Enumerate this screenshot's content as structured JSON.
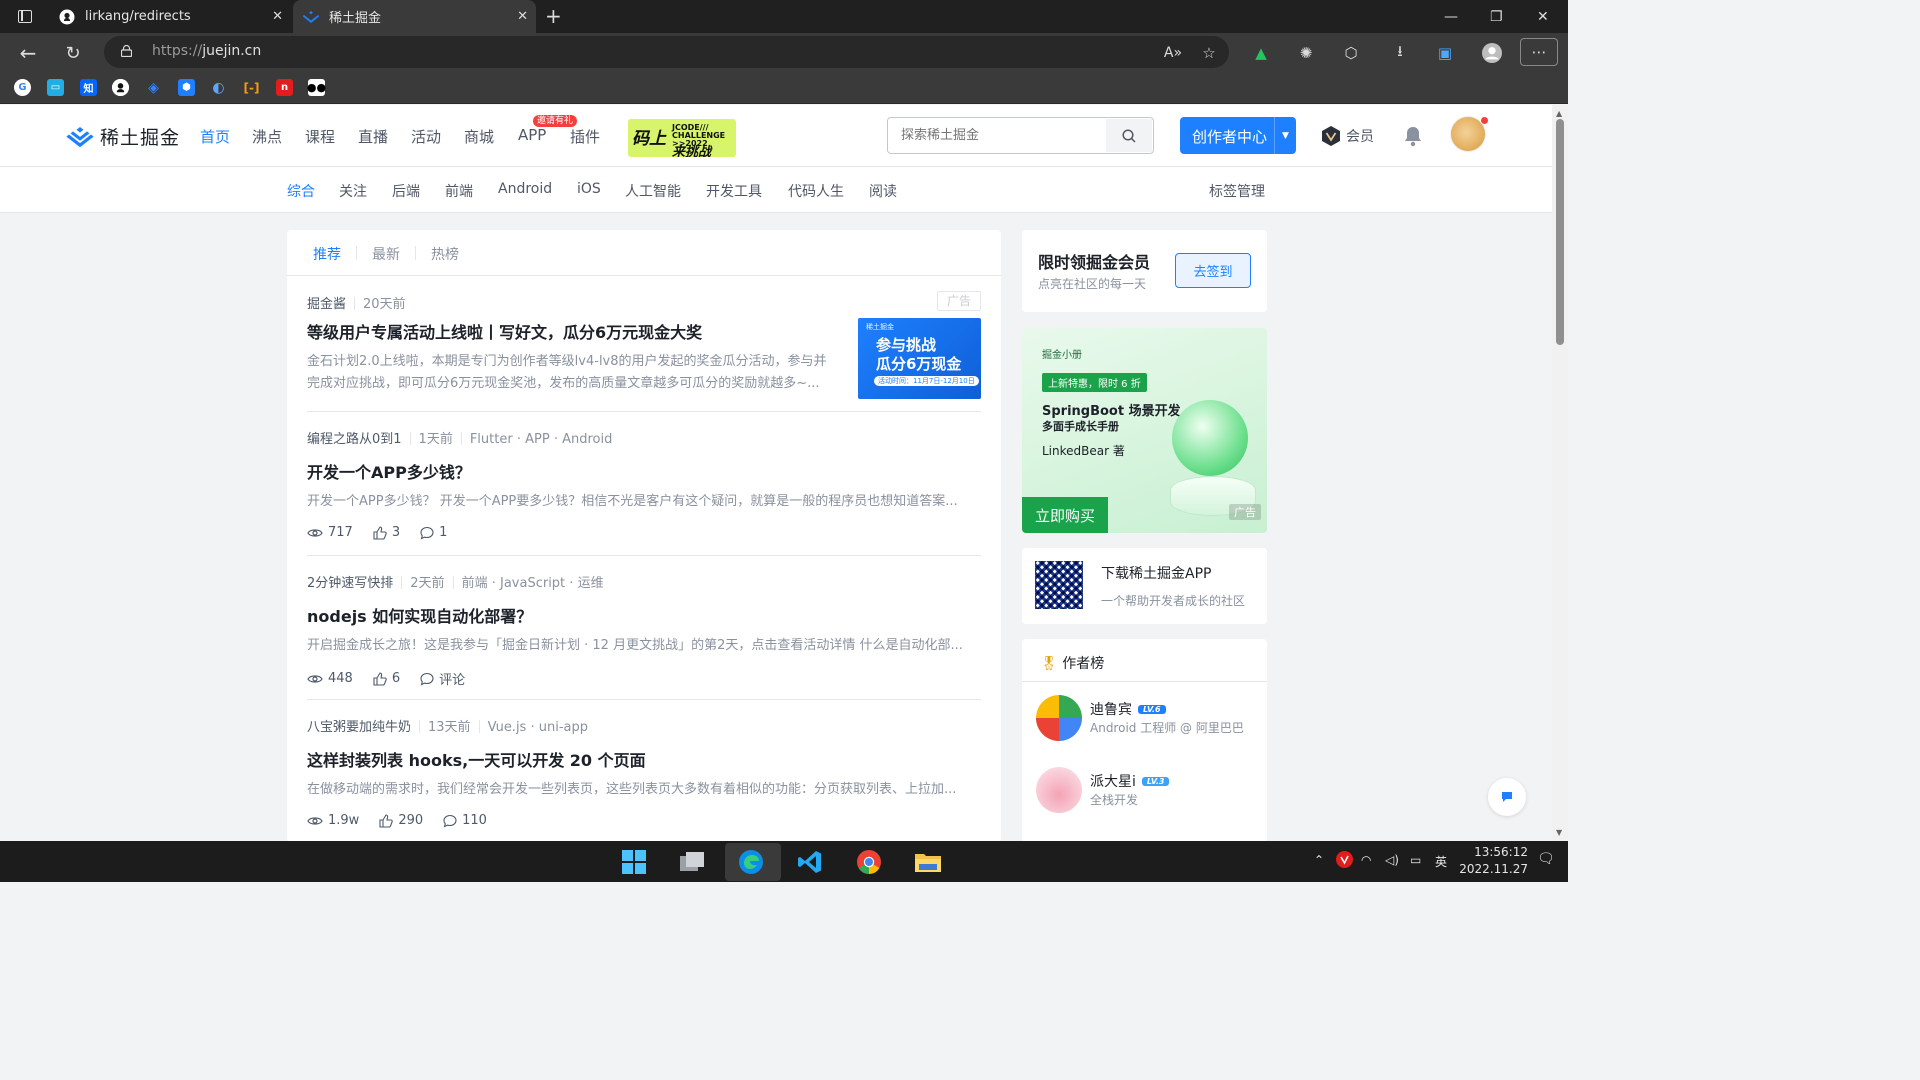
{
  "browser": {
    "tabs": [
      {
        "title": "lirkang/redirects",
        "icon": "github-icon"
      },
      {
        "title": "稀土掘金",
        "icon": "juejin-icon"
      }
    ],
    "url_scheme": "https://",
    "url_host": "juejin.cn",
    "bookmarks": [
      "google-icon",
      "bilibili-icon",
      "zhihu-icon",
      "github-icon",
      "diamond-icon",
      "hex-icon",
      "shield-icon",
      "bracket-icon",
      "n-icon",
      "medium-icon"
    ],
    "bookmark_zhi": "知"
  },
  "site": {
    "logo": "稀土掘金",
    "nav": [
      "首页",
      "沸点",
      "课程",
      "直播",
      "活动",
      "商城",
      "APP",
      "插件"
    ],
    "app_badge": "邀请有礼",
    "promo": {
      "big": "码上",
      "small": "JCODE/// CHALLENGE >>2022",
      "tag": "来挑战"
    },
    "search_placeholder": "探索稀土掘金",
    "creator": "创作者中心",
    "vip": "会员",
    "subnav": [
      "综合",
      "关注",
      "后端",
      "前端",
      "Android",
      "iOS",
      "人工智能",
      "开发工具",
      "代码人生",
      "阅读"
    ],
    "tag_manage": "标签管理"
  },
  "feed": {
    "tabs": [
      "推荐",
      "最新",
      "热榜"
    ],
    "ad": {
      "author": "掘金酱",
      "time": "20天前",
      "label": "广告",
      "title": "等级用户专属活动上线啦丨写好文，瓜分6万元现金大奖",
      "desc": "金石计划2.0上线啦，本期是专门为创作者等级lv4-lv8的用户发起的奖金瓜分活动，参与并完成对应挑战，即可瓜分6万元现金奖池，发布的高质量文章越多可瓜分的奖励就越多~...",
      "thumb": {
        "brand": "稀土掘金",
        "line1": "参与挑战",
        "line2": "瓜分6万现金",
        "date": "活动时间：11月7日-12月10日"
      }
    },
    "articles": [
      {
        "author": "编程之路从0到1",
        "time": "1天前",
        "tags": [
          "Flutter",
          "APP",
          "Android"
        ],
        "title": "开发一个APP多少钱？",
        "desc": "开发一个APP多少钱？ 开发一个APP要多少钱？相信不光是客户有这个疑问，就算是一般的程序员也想知道答案...",
        "views": "717",
        "likes": "3",
        "comments": "1"
      },
      {
        "author": "2分钟速写快排",
        "time": "2天前",
        "tags": [
          "前端",
          "JavaScript",
          "运维"
        ],
        "title": "nodejs 如何实现自动化部署？",
        "desc": "开启掘金成长之旅！这是我参与「掘金日新计划 · 12 月更文挑战」的第2天，点击查看活动详情 什么是自动化部...",
        "views": "448",
        "likes": "6",
        "comments": "评论"
      },
      {
        "author": "八宝粥要加纯牛奶",
        "time": "13天前",
        "tags": [
          "Vue.js",
          "uni-app"
        ],
        "title": "这样封装列表 hooks,一天可以开发 20 个页面",
        "desc": "在做移动端的需求时，我们经常会开发一些列表页，这些列表页大多数有着相似的功能：分页获取列表、上拉加...",
        "views": "1.9w",
        "likes": "290",
        "comments": "110"
      }
    ]
  },
  "sidebar": {
    "signin": {
      "title": "限时领掘金会员",
      "subtitle": "点亮在社区的每一天",
      "button": "去签到"
    },
    "bookad": {
      "brand": "掘金小册",
      "tag": "上新特惠，限时 6 折",
      "title": "SpringBoot 场景开发",
      "subtitle": "多面手成长手册",
      "author": "LinkedBear 著",
      "button": "立即购买",
      "ad": "广告"
    },
    "appdl": {
      "title": "下载稀土掘金APP",
      "subtitle": "一个帮助开发者成长的社区"
    },
    "authors": {
      "header": "作者榜",
      "list": [
        {
          "name": "迪鲁宾",
          "level": "LV.6",
          "desc": "Android 工程师 @ 阿里巴巴"
        },
        {
          "name": "派大星i",
          "level": "LV.3",
          "desc": "全栈开发"
        }
      ]
    }
  },
  "taskbar": {
    "apps": [
      "windows-start-icon",
      "file-explorer-icon",
      "edge-icon",
      "vscode-icon",
      "chrome-icon",
      "folder-icon"
    ],
    "ime": "英",
    "time": "13:56:12",
    "date": "2022.11.27"
  },
  "colors": {
    "accent": "#1e80ff",
    "green": "#1aa34a",
    "text": "#1d2129",
    "muted": "#8a919f"
  }
}
